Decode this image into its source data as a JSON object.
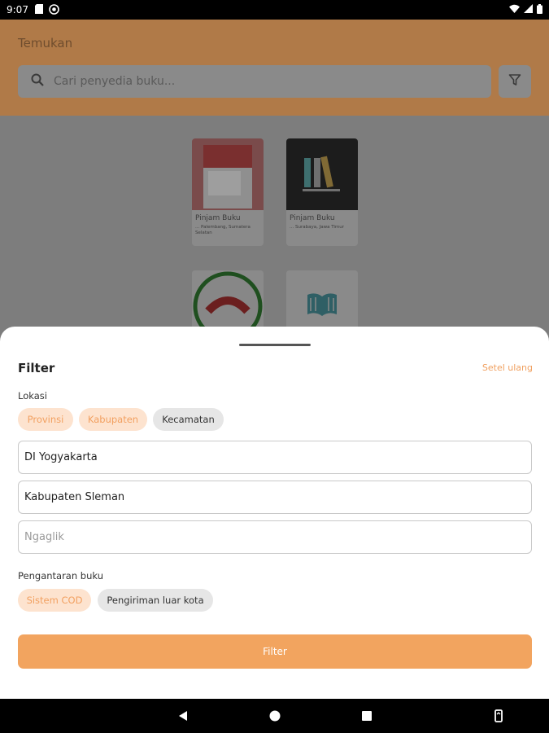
{
  "status_bar": {
    "time": "9:07",
    "icons_left": [
      "sd-card-icon",
      "circle-notification-icon"
    ],
    "icons_right": [
      "wifi-icon",
      "signal-icon",
      "battery-icon"
    ]
  },
  "header": {
    "title": "Temukan",
    "search_placeholder": "Cari penyedia buku..."
  },
  "cards": [
    {
      "title": "Pinjam Buku",
      "subtitle": "... Palembang, Sumatera Selatan"
    },
    {
      "title": "Pinjam Buku",
      "subtitle": "... Surabaya, Jawa Timur"
    },
    {
      "title": "",
      "subtitle": ""
    },
    {
      "title": "",
      "subtitle": ""
    }
  ],
  "filter": {
    "title": "Filter",
    "reset_label": "Setel ulang",
    "location_label": "Lokasi",
    "location_chips": [
      {
        "label": "Provinsi",
        "active": true
      },
      {
        "label": "Kabupaten",
        "active": true
      },
      {
        "label": "Kecamatan",
        "active": false
      }
    ],
    "province_value": "DI Yogyakarta",
    "regency_value": "Kabupaten Sleman",
    "district_placeholder": "Ngaglik",
    "delivery_label": "Pengantaran buku",
    "delivery_chips": [
      {
        "label": "Sistem COD",
        "active": true
      },
      {
        "label": "Pengiriman luar kota",
        "active": false
      }
    ],
    "submit_label": "Filter"
  },
  "colors": {
    "accent": "#f2a45f",
    "chip_active_bg": "#fde3cf",
    "chip_active_text": "#f2a060",
    "header_bg": "#b07a48"
  }
}
